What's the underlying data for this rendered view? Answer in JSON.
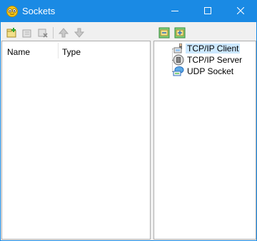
{
  "window": {
    "title": "Sockets",
    "app_icon": "socket-eyes-icon",
    "titlebar_color": "#1a8ae4",
    "controls": [
      "minimize-icon",
      "maximize-icon",
      "close-icon"
    ]
  },
  "toolbar_left": {
    "buttons": [
      {
        "name": "new-socket-button",
        "icon": "new-item-icon"
      },
      {
        "name": "edit-socket-button",
        "icon": "edit-item-icon"
      },
      {
        "name": "delete-socket-button",
        "icon": "delete-item-icon"
      },
      {
        "name": "move-up-button",
        "icon": "arrow-up-icon"
      },
      {
        "name": "move-down-button",
        "icon": "arrow-down-icon"
      }
    ]
  },
  "toolbar_right": {
    "buttons": [
      {
        "name": "expand-all-button",
        "icon": "expand-tree-icon"
      },
      {
        "name": "collapse-all-button",
        "icon": "collapse-tree-icon"
      }
    ]
  },
  "list": {
    "columns": [
      "Name",
      "Type"
    ],
    "rows": []
  },
  "tree": {
    "items": [
      {
        "label": "TCP/IP Client",
        "icon": "client-icon",
        "selected": true
      },
      {
        "label": "TCP/IP Server",
        "icon": "server-icon",
        "selected": false
      },
      {
        "label": "UDP Socket",
        "icon": "udp-icon",
        "selected": false
      }
    ]
  }
}
